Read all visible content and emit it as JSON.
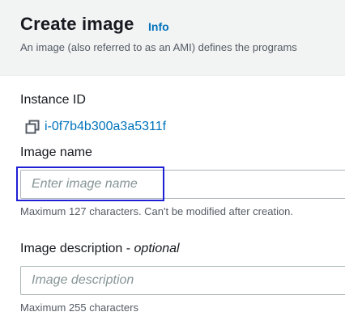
{
  "header": {
    "title": "Create image",
    "info_label": "Info",
    "description": "An image (also referred to as an AMI) defines the programs"
  },
  "instance": {
    "label": "Instance ID",
    "id": "i-0f7b4b300a3a5311f",
    "copy_icon": "copy-icon"
  },
  "image_name": {
    "label": "Image name",
    "value": "",
    "placeholder": "Enter image name",
    "hint": "Maximum 127 characters. Can't be modified after creation."
  },
  "image_description": {
    "label": "Image description - ",
    "optional_label": "optional",
    "value": "",
    "placeholder": "Image description",
    "hint": "Maximum 255 characters"
  },
  "colors": {
    "link": "#0073bb",
    "focus": "#1f1fd6",
    "header_bg": "#f2f3f3"
  }
}
